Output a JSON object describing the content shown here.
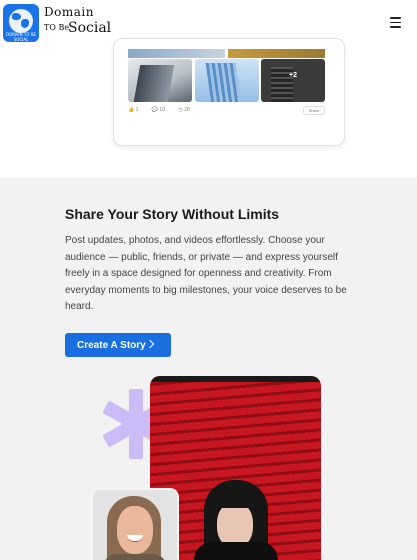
{
  "brand": {
    "name_line1": "Domain",
    "name_line2a": "TO Be",
    "name_line2b": "Social",
    "badge_text": "DOMAIN TO BE SOCIAL",
    "logo_icon": "globe-icon",
    "color": "#1a73e8"
  },
  "header": {
    "menu_icon": "hamburger-menu-icon"
  },
  "preview_card": {
    "more_photos": "+2",
    "likes": "1",
    "comments": "10",
    "views": "20",
    "share_label": "Share"
  },
  "section": {
    "title": "Share Your Story Without Limits",
    "body": "Post updates, photos, and videos effortlessly. Choose your audience — public, friends, or private — and express yourself freely in a space designed for openness and creativity. From everyday moments to big milestones, your voice deserves to be heard.",
    "cta_label": "Create A Story",
    "cta_icon": "chevron-right-icon",
    "cta_color": "#1a6fe0",
    "accent_shape_color": "#cbbcf7"
  }
}
